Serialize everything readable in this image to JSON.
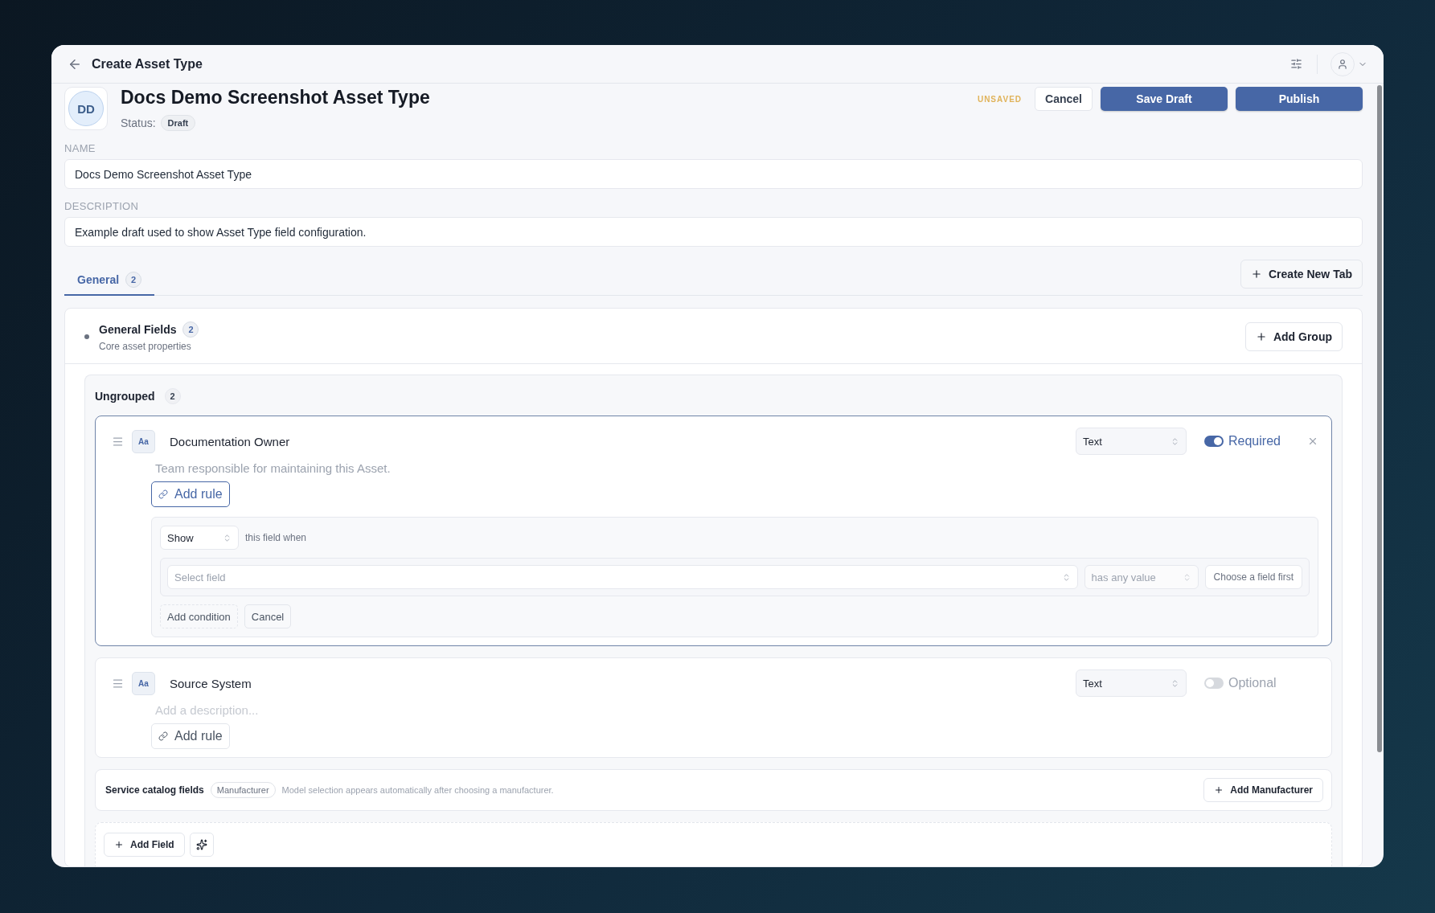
{
  "header": {
    "title": "Create Asset Type"
  },
  "asset": {
    "initials": "DD",
    "name": "Docs Demo Screenshot Asset Type",
    "status_label": "Status:",
    "status": "Draft"
  },
  "actions": {
    "unsaved": "UNSAVED",
    "buttons": [
      {
        "label": "Cancel",
        "kind": "secondary"
      },
      {
        "label": "Save Draft",
        "kind": "primary"
      },
      {
        "label": "Publish",
        "kind": "primary"
      }
    ]
  },
  "form": [
    {
      "label": "NAME",
      "value": "Docs Demo Screenshot Asset Type"
    },
    {
      "label": "DESCRIPTION",
      "value": "Example draft used to show Asset Type field configuration."
    }
  ],
  "tabs": [
    {
      "label": "General",
      "count": "2",
      "selected": true
    }
  ],
  "create_tab_button": "Create New Tab",
  "group": {
    "title": "General Fields",
    "count": "2",
    "subtitle": "Core asset properties",
    "add_button": "Add Group",
    "ungrouped": {
      "title": "Ungrouped",
      "count": "2"
    },
    "fields": [
      {
        "name": "Documentation Owner",
        "type_icon": "Aa",
        "description": "Team responsible for maintaining this Asset.",
        "type": "Text",
        "required": true,
        "toggle_label": "Required",
        "selected": true,
        "removable": true,
        "rule_button": "Add rule",
        "rule_editor": {
          "action": "Show",
          "action_text": "this field when",
          "field_placeholder": "Select field",
          "operator": "has any value",
          "value_placeholder": "Choose a field first",
          "buttons": [
            "Add condition",
            "Cancel"
          ]
        }
      },
      {
        "name": "Source System",
        "type_icon": "Aa",
        "placeholder": "Add a description...",
        "type": "Text",
        "required": false,
        "toggle_label": "Optional",
        "selected": false,
        "removable": false,
        "rule_button": "Add rule"
      }
    ]
  },
  "catalog": {
    "title": "Service catalog fields",
    "tag": "Manufacturer",
    "note": "Model selection appears automatically after choosing a manufacturer.",
    "button": "Add Manufacturer"
  },
  "footer": {
    "add_field": "Add Field"
  }
}
